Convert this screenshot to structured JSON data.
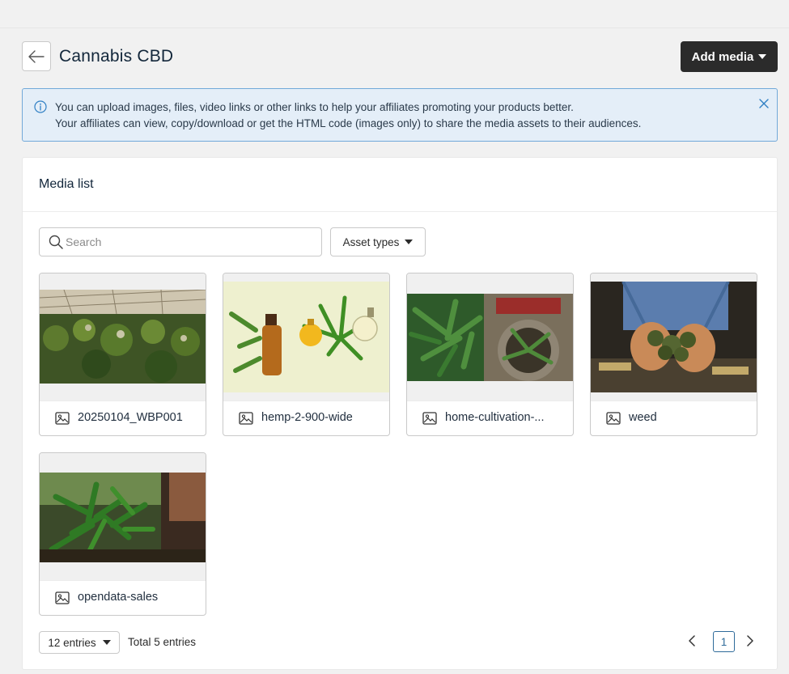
{
  "header": {
    "title": "Cannabis CBD",
    "add_media_label": "Add media"
  },
  "info_banner": {
    "line1": "You can upload images, files, video links or other links to help your affiliates promoting your products better.",
    "line2": "Your affiliates can view, copy/download or get the HTML code (images only) to share the media assets to their audiences."
  },
  "media_list": {
    "title": "Media list",
    "search_placeholder": "Search",
    "asset_types_label": "Asset types",
    "items": [
      {
        "name": "20250104_WBP001",
        "icon": "image-icon"
      },
      {
        "name": "hemp-2-900-wide",
        "icon": "image-icon"
      },
      {
        "name": "home-cultivation-...",
        "icon": "image-icon"
      },
      {
        "name": "weed",
        "icon": "image-icon"
      },
      {
        "name": "opendata-sales",
        "icon": "image-icon"
      }
    ]
  },
  "pagination": {
    "per_page_label": "12 entries",
    "total_label": "Total 5 entries",
    "current_page": "1"
  },
  "colors": {
    "primary_dark": "#2b2b2b",
    "banner_bg": "#e4eef8",
    "banner_border": "#72a9d9",
    "link_blue": "#2f6b9a"
  }
}
